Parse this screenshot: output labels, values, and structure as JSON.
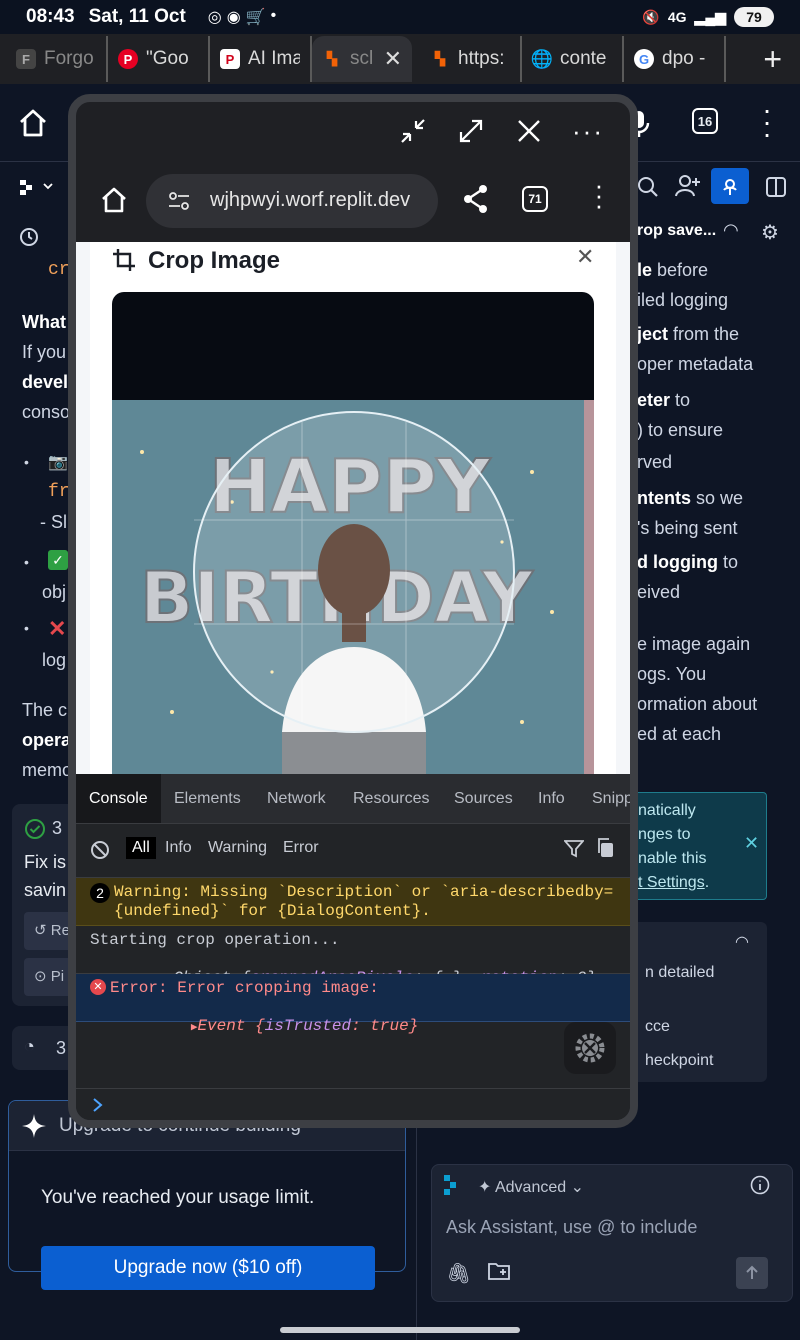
{
  "status_bar": {
    "time": "08:43",
    "date": "Sat, 11 Oct",
    "network": "4G",
    "battery": "79"
  },
  "browser_tabs": [
    {
      "label": "Forgo",
      "favicon": "F"
    },
    {
      "label": "\"Goo",
      "favicon": "P"
    },
    {
      "label": "AI Ima",
      "favicon": "P"
    },
    {
      "label": "scl",
      "favicon": "R",
      "active": true
    },
    {
      "label": "https:",
      "favicon": "R"
    },
    {
      "label": "conte",
      "favicon": "globe"
    },
    {
      "label": "dpo -",
      "favicon": "G"
    }
  ],
  "app_bar": {
    "tab_count": "16"
  },
  "left_panel": {
    "code_fragment_1": "cr",
    "what_label": "What",
    "line_if_you": "If you",
    "devel_label": "devel",
    "conso_label": "conso",
    "bullet_1_code": "fr",
    "bullet_1_text": "- Sl",
    "bullet_2_text": "obj",
    "bullet_3_text": "log",
    "the_c": "The c",
    "opera": "opera",
    "memo": "memo",
    "card_count": "3",
    "fix_is": "Fix is",
    "savin": "savin",
    "btn_r": "Re",
    "btn_p": "Pi",
    "speed_count": "3",
    "upgrade_title": "Upgrade to continue building",
    "upgrade_message": "You've reached your usage limit.",
    "upgrade_button": "Upgrade now ($10 off)"
  },
  "right_panel": {
    "crop_save_title": "rop save...",
    "lines": [
      {
        "text": "le before",
        "bold_part": "le"
      },
      {
        "text": "iled logging"
      },
      {
        "text": "ject from the",
        "bold_part": "ject"
      },
      {
        "text": "oper metadata"
      },
      {
        "text": "eter to",
        "bold_part": "eter"
      },
      {
        "text": ") to ensure"
      },
      {
        "text": "rved"
      },
      {
        "text": "ntents so we",
        "bold_part": "ntents"
      },
      {
        "text": "'s being sent"
      },
      {
        "text": "d logging to",
        "bold_part": "d logging"
      },
      {
        "text": "eived"
      },
      {
        "text": "e image again"
      },
      {
        "text": "ogs. You"
      },
      {
        "text": "ormation about"
      },
      {
        "text": "ed at each"
      }
    ],
    "notice_lines": [
      "natically",
      "nges to",
      "nable this",
      "t Settings"
    ],
    "card_lines": [
      "n detailed",
      "cce",
      "heckpoint"
    ],
    "composer_mode": "Advanced",
    "composer_placeholder": "Ask Assistant, use @ to include"
  },
  "popup": {
    "url": "wjhpwyi.worf.replit.dev",
    "tab_count": "71",
    "dialog_title": "Crop Image",
    "photo_banner": "HAPPY BIRTHDAY",
    "console": {
      "tabs": [
        "Console",
        "Elements",
        "Network",
        "Resources",
        "Sources",
        "Info",
        "Snipp"
      ],
      "filters": [
        "All",
        "Info",
        "Warning",
        "Error"
      ],
      "warning_count": "2",
      "warning_line_1": "Warning: Missing `Description` or `aria-describedby=",
      "warning_line_2": "{undefined}` for {DialogContent}.",
      "log_line_1": "Starting crop operation...",
      "log_line_2_prefix": "Object {",
      "log_line_2_key1": "croppedAreaPixels",
      "log_line_2_val1": ": {…}, ",
      "log_line_2_key2": "rotation",
      "log_line_2_val2": ": 0}",
      "error_line_1": "Error: Error cropping image:",
      "error_line_2_prefix": "Event {",
      "error_line_2_key": "isTrusted",
      "error_line_2_val": ": true}"
    }
  },
  "colors": {
    "page_bg": "#0e1525",
    "accent_blue": "#0b5fd1",
    "warning_bg": "#3f3611",
    "error_bg": "#132a4a"
  }
}
